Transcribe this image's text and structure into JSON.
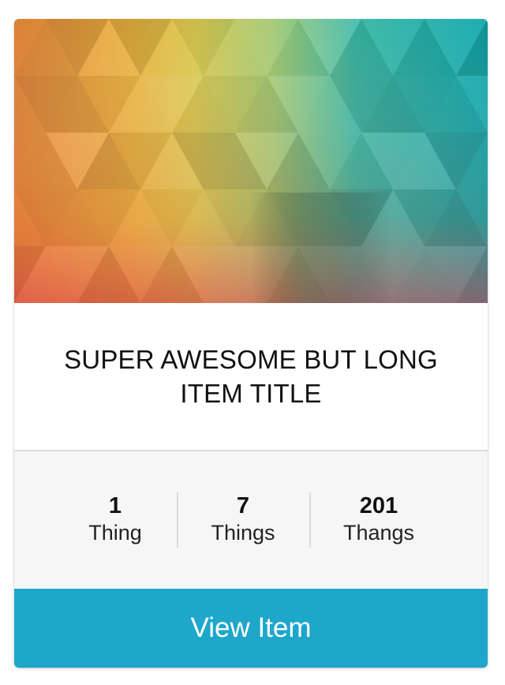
{
  "card": {
    "image": {
      "alt": "Colorful geometric triangle pattern"
    },
    "title": "SUPER AWESOME BUT LONG ITEM TITLE",
    "stats": [
      {
        "value": "1",
        "label": "Thing"
      },
      {
        "value": "7",
        "label": "Things"
      },
      {
        "value": "201",
        "label": "Thangs"
      }
    ],
    "button_label": "View Item",
    "colors": {
      "button": "#1fa6cb",
      "stats_background": "#f6f6f6",
      "divider": "#d9d9d9"
    }
  }
}
